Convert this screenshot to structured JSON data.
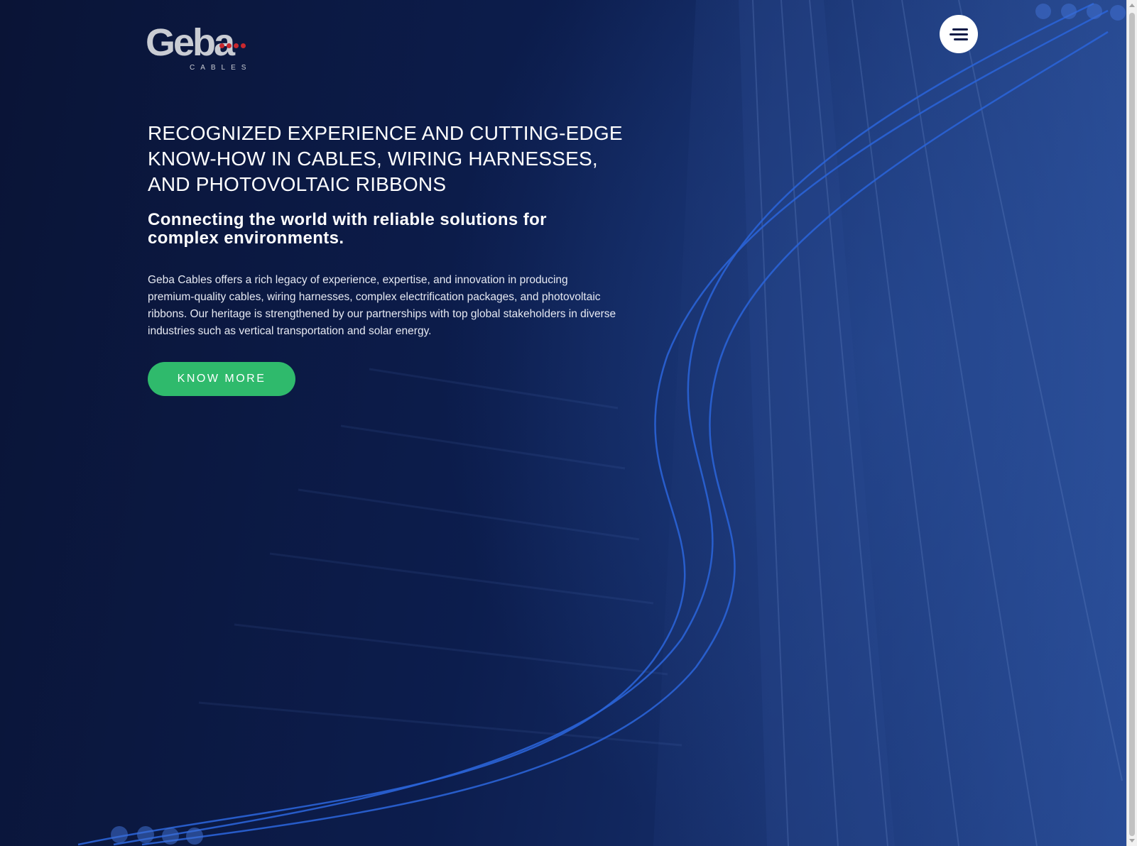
{
  "brand": {
    "logo_word": "Geba",
    "logo_sub": "CABLES"
  },
  "nav": {
    "menu_icon": "hamburger-menu-icon"
  },
  "hero": {
    "headline": "RECOGNIZED EXPERIENCE AND CUTTING-EDGE KNOW-HOW IN CABLES, WIRING HARNESSES, AND PHOTOVOLTAIC RIBBONS",
    "subheadline": "Connecting the world with reliable solutions for complex environments.",
    "body": "Geba Cables offers a rich legacy of experience, expertise, and innovation in producing premium-quality cables, wiring harnesses, complex electrification packages, and photovoltaic ribbons. Our heritage is strengthened by our partnerships with top global stakeholders in diverse industries such as vertical transportation and solar energy.",
    "cta_label": "KNOW MORE"
  },
  "colors": {
    "background": "#0b1a45",
    "accent": "#2fba6c",
    "cable_lines": "#2a63d6",
    "logo_dots": "#c8282e"
  }
}
